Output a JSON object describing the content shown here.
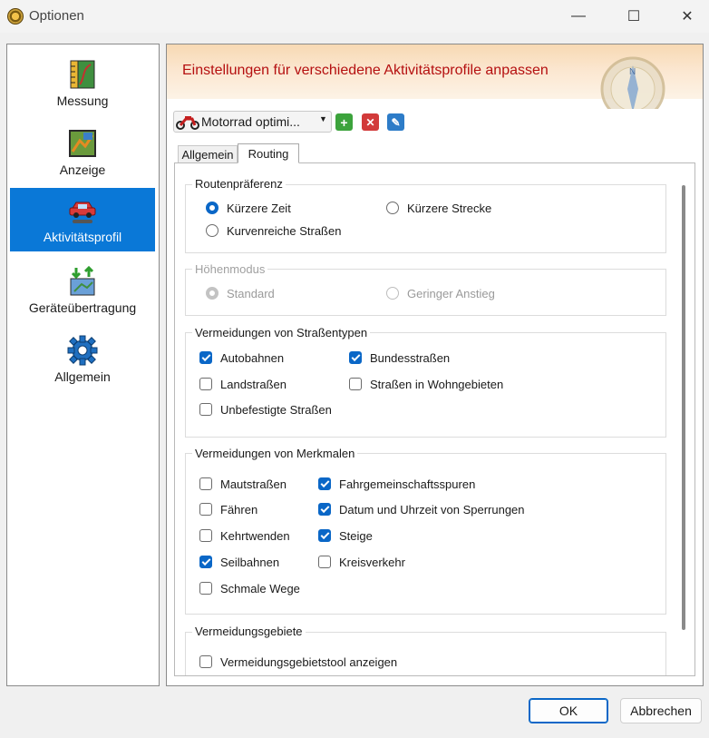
{
  "window": {
    "title": "Optionen",
    "minimize": "—",
    "maximize": "☐",
    "close": "✕"
  },
  "sidebar": {
    "items": [
      {
        "label": "Messung",
        "icon": "ruler-map-icon"
      },
      {
        "label": "Anzeige",
        "icon": "map-display-icon"
      },
      {
        "label": "Aktivitätsprofil",
        "icon": "car-profile-icon",
        "active": true
      },
      {
        "label": "Geräteübertragung",
        "icon": "device-transfer-icon"
      },
      {
        "label": "Allgemein",
        "icon": "gear-icon"
      }
    ]
  },
  "header": {
    "title": "Einstellungen für verschiedene Aktivitätsprofile anpassen",
    "title_color": "#b51010"
  },
  "profile": {
    "selected": "Motorrad optimi...",
    "icon": "motorcycle-icon",
    "add_label": "+",
    "delete_label": "✕",
    "edit_label": "✎"
  },
  "tabs": [
    {
      "label": "Allgemein",
      "active": false
    },
    {
      "label": "Routing",
      "active": true
    }
  ],
  "groups": {
    "route_pref": {
      "title": "Routenpräferenz",
      "options": [
        {
          "label": "Kürzere Zeit",
          "checked": true
        },
        {
          "label": "Kürzere Strecke",
          "checked": false
        },
        {
          "label": "Kurvenreiche Straßen",
          "checked": false
        }
      ]
    },
    "elevation": {
      "title": "Höhenmodus",
      "disabled": true,
      "options": [
        {
          "label": "Standard",
          "checked": true
        },
        {
          "label": "Geringer Anstieg",
          "checked": false
        }
      ]
    },
    "road_types": {
      "title": "Vermeidungen von Straßentypen",
      "options": [
        {
          "label": "Autobahnen",
          "checked": true
        },
        {
          "label": "Bundesstraßen",
          "checked": true
        },
        {
          "label": "Landstraßen",
          "checked": false
        },
        {
          "label": "Straßen in Wohngebieten",
          "checked": false
        },
        {
          "label": "Unbefestigte Straßen",
          "checked": false
        }
      ]
    },
    "features": {
      "title": "Vermeidungen von Merkmalen",
      "options": [
        {
          "label": "Mautstraßen",
          "checked": false
        },
        {
          "label": "Fahrgemeinschaftsspuren",
          "checked": true
        },
        {
          "label": "Fähren",
          "checked": false
        },
        {
          "label": "Datum und Uhrzeit von Sperrungen",
          "checked": true
        },
        {
          "label": "Kehrtwenden",
          "checked": false
        },
        {
          "label": "Steige",
          "checked": true
        },
        {
          "label": "Seilbahnen",
          "checked": true
        },
        {
          "label": "Kreisverkehr",
          "checked": false
        },
        {
          "label": "Schmale Wege",
          "checked": false
        }
      ]
    },
    "areas": {
      "title": "Vermeidungsgebiete",
      "options": [
        {
          "label": "Vermeidungsgebietstool anzeigen",
          "checked": false
        }
      ]
    }
  },
  "footer": {
    "ok_label": "OK",
    "cancel_label": "Abbrechen"
  },
  "colors": {
    "accent": "#0a67c7",
    "sidebar_active": "#0a78d7"
  }
}
